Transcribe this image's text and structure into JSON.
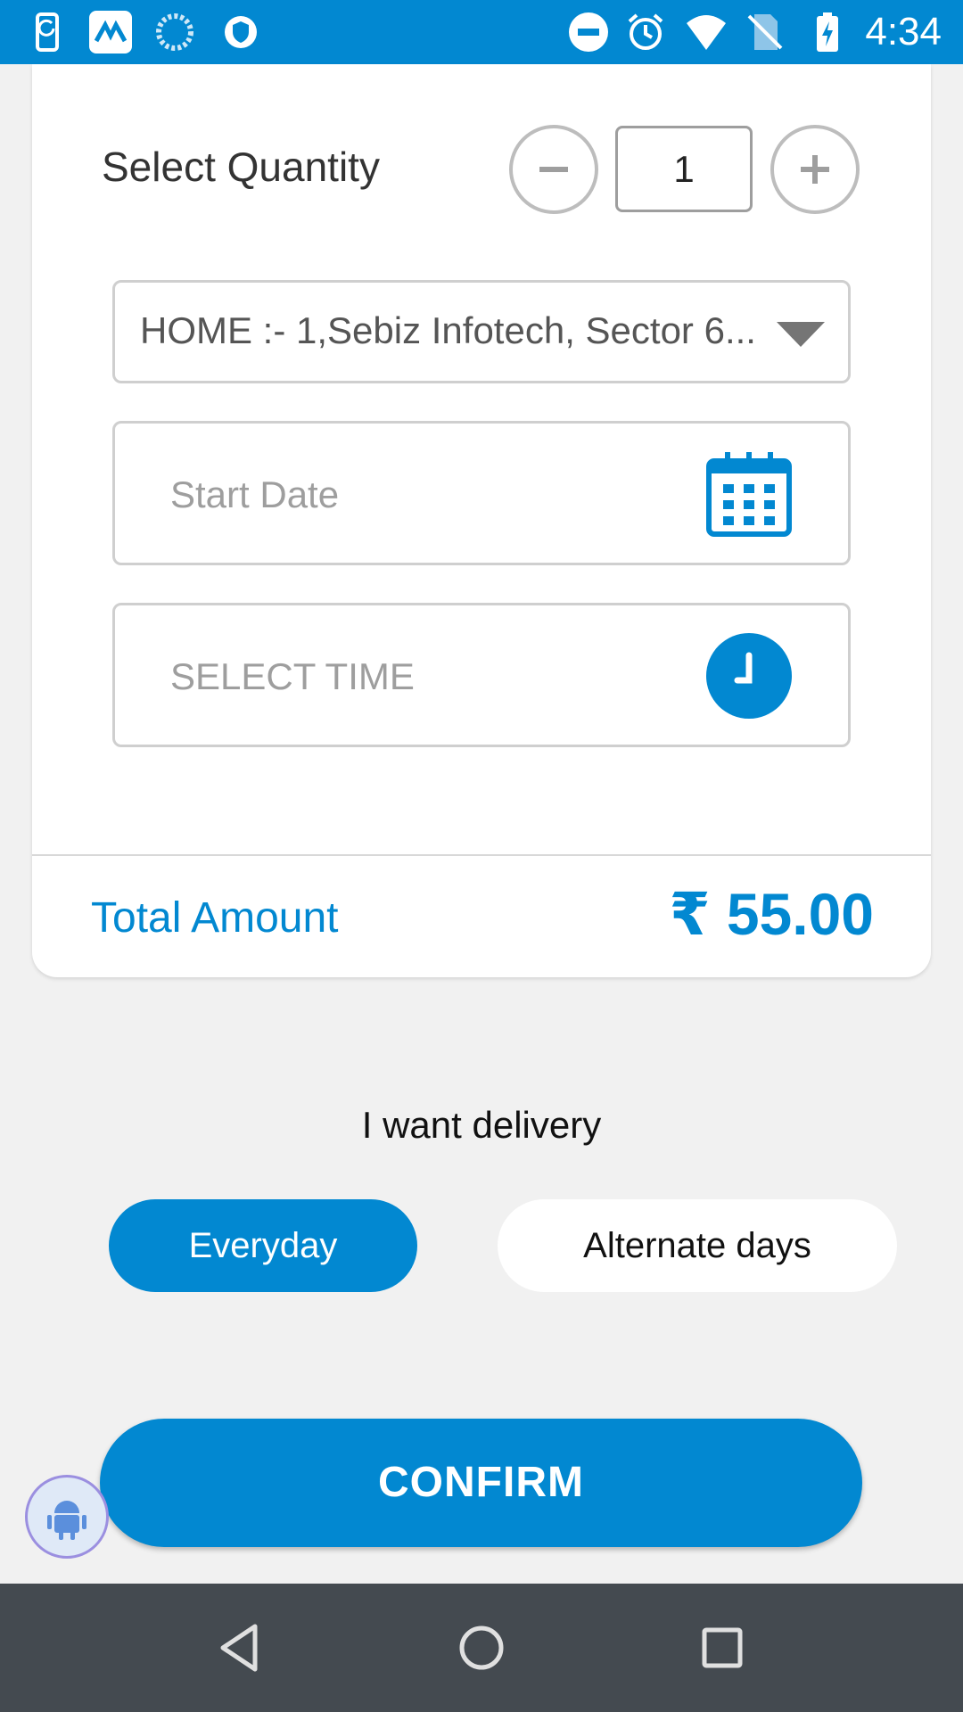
{
  "status_bar": {
    "time": "4:34",
    "left_icons": [
      "phone-sync-icon",
      "app-logo-icon",
      "loading-icon",
      "vpn-shield-icon"
    ],
    "right_icons": [
      "do-not-disturb-icon",
      "alarm-icon",
      "wifi-icon",
      "no-sim-icon",
      "battery-charging-icon"
    ]
  },
  "quantity": {
    "label": "Select Quantity",
    "value": "1"
  },
  "address": {
    "selected": "HOME :- 1,Sebiz Infotech, Sector 6..."
  },
  "start_date": {
    "placeholder": "Start Date"
  },
  "time_select": {
    "placeholder": "SELECT TIME"
  },
  "total": {
    "label": "Total Amount",
    "value": "₹ 55.00"
  },
  "delivery": {
    "label": "I want delivery",
    "options": [
      "Everyday",
      "Alternate days"
    ],
    "selected": "Everyday"
  },
  "confirm_label": "CONFIRM",
  "colors": {
    "primary": "#0288d1",
    "background": "#f1f1f1",
    "nav_bar": "#444a50"
  }
}
